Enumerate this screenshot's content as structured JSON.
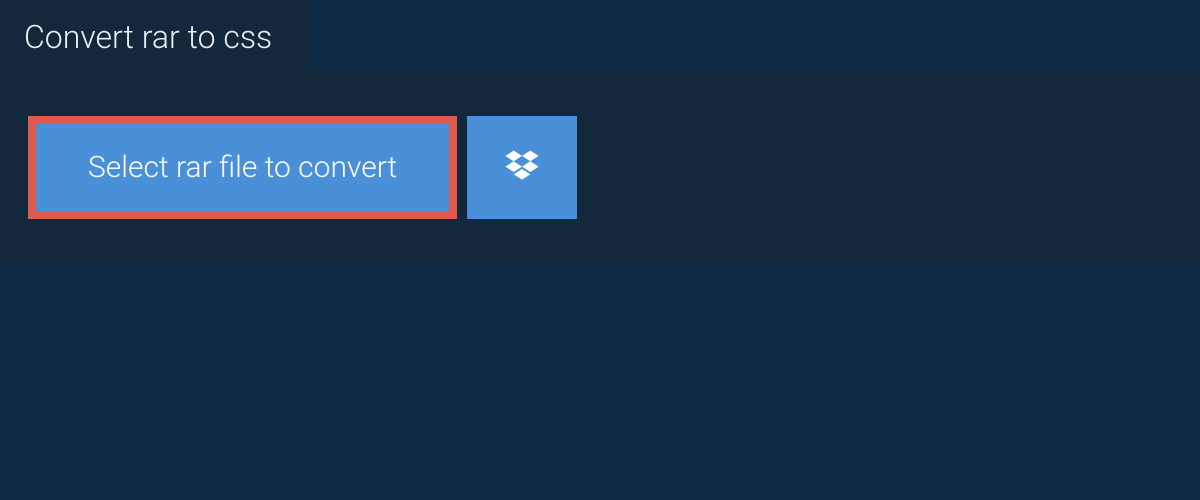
{
  "tab": {
    "label": "Convert rar to css"
  },
  "actions": {
    "select_file_label": "Select rar file to convert"
  },
  "colors": {
    "bg": "#0d2a42",
    "panel": "#14283b",
    "button": "#4a90d9",
    "highlight_border": "#e05a4f",
    "text": "#ffffff"
  }
}
